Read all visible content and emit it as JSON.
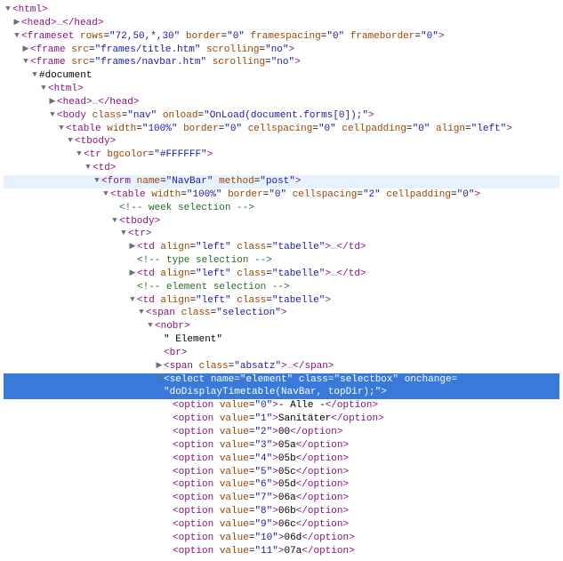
{
  "root": "<html>",
  "head": {
    "open": "<head>",
    "close": "</head>",
    "ellipsis": "…"
  },
  "frameset": {
    "tag": "frameset",
    "attrs": [
      {
        "n": "rows",
        "v": "72,50,*,30"
      },
      {
        "n": "border",
        "v": "0"
      },
      {
        "n": "framespacing",
        "v": "0"
      },
      {
        "n": "frameborder",
        "v": "0"
      }
    ]
  },
  "frame1": {
    "tag": "frame",
    "attrs": [
      {
        "n": "src",
        "v": "frames/title.htm"
      },
      {
        "n": "scrolling",
        "v": "no"
      }
    ]
  },
  "frame2": {
    "tag": "frame",
    "attrs": [
      {
        "n": "src",
        "v": "frames/navbar.htm"
      },
      {
        "n": "scrolling",
        "v": "no"
      }
    ]
  },
  "docNode": "#document",
  "innerHtml": "<html>",
  "innerHead": {
    "open": "<head>",
    "close": "</head>",
    "ellipsis": "…"
  },
  "body": {
    "tag": "body",
    "attrs": [
      {
        "n": "class",
        "v": "nav"
      },
      {
        "n": "onload",
        "v": "OnLoad(document.forms[0]);"
      }
    ]
  },
  "table1": {
    "tag": "table",
    "attrs": [
      {
        "n": "width",
        "v": "100%"
      },
      {
        "n": "border",
        "v": "0"
      },
      {
        "n": "cellspacing",
        "v": "0"
      },
      {
        "n": "cellpadding",
        "v": "0"
      },
      {
        "n": "align",
        "v": "left"
      }
    ]
  },
  "tbody": "<tbody>",
  "tr1": {
    "tag": "tr",
    "attrs": [
      {
        "n": "bgcolor",
        "v": "#FFFFFF"
      }
    ]
  },
  "td1": "<td>",
  "form": {
    "tag": "form",
    "attrs": [
      {
        "n": "name",
        "v": "NavBar"
      },
      {
        "n": "method",
        "v": "post"
      }
    ]
  },
  "table2": {
    "tag": "table",
    "attrs": [
      {
        "n": "width",
        "v": "100%"
      },
      {
        "n": "border",
        "v": "0"
      },
      {
        "n": "cellspacing",
        "v": "2"
      },
      {
        "n": "cellpadding",
        "v": "0"
      }
    ]
  },
  "comments": {
    "week": "<!-- week selection -->",
    "type": "<!-- type selection -->",
    "element": "<!-- element selection -->"
  },
  "tr2": "<tr>",
  "tdTabelle": {
    "tag": "td",
    "attrs": [
      {
        "n": "align",
        "v": "left"
      },
      {
        "n": "class",
        "v": "tabelle"
      }
    ],
    "close": "</td>",
    "ellipsis": "…"
  },
  "spanSelection": {
    "tag": "span",
    "attrs": [
      {
        "n": "class",
        "v": "selection"
      }
    ]
  },
  "nobr": "<nobr>",
  "elementText": "\" Element\"",
  "br": "<br>",
  "spanAbsatz": {
    "tag": "span",
    "attrs": [
      {
        "n": "class",
        "v": "absatz"
      }
    ],
    "close": "</span>",
    "ellipsis": "…"
  },
  "select": {
    "tag": "select",
    "attrs1": [
      {
        "n": "name",
        "v": "element"
      },
      {
        "n": "class",
        "v": "selectbox"
      }
    ],
    "attrOnchange": "onchange",
    "line2": "\"doDisplayTimetable(NavBar, topDir);\">"
  },
  "options": [
    {
      "value": "0",
      "text": "- Alle -"
    },
    {
      "value": "1",
      "text": "Sanitäter"
    },
    {
      "value": "2",
      "text": "00"
    },
    {
      "value": "3",
      "text": "05a"
    },
    {
      "value": "4",
      "text": "05b"
    },
    {
      "value": "5",
      "text": "05c"
    },
    {
      "value": "6",
      "text": "05d"
    },
    {
      "value": "7",
      "text": "06a"
    },
    {
      "value": "8",
      "text": "06b"
    },
    {
      "value": "9",
      "text": "06c"
    },
    {
      "value": "10",
      "text": "06d"
    },
    {
      "value": "11",
      "text": "07a"
    }
  ],
  "optionTag": {
    "open": "<option",
    "valueAttr": "value",
    "mid": ">",
    "close": "</option>"
  },
  "closeBracket": ">",
  "eq": "=",
  "q": "\""
}
